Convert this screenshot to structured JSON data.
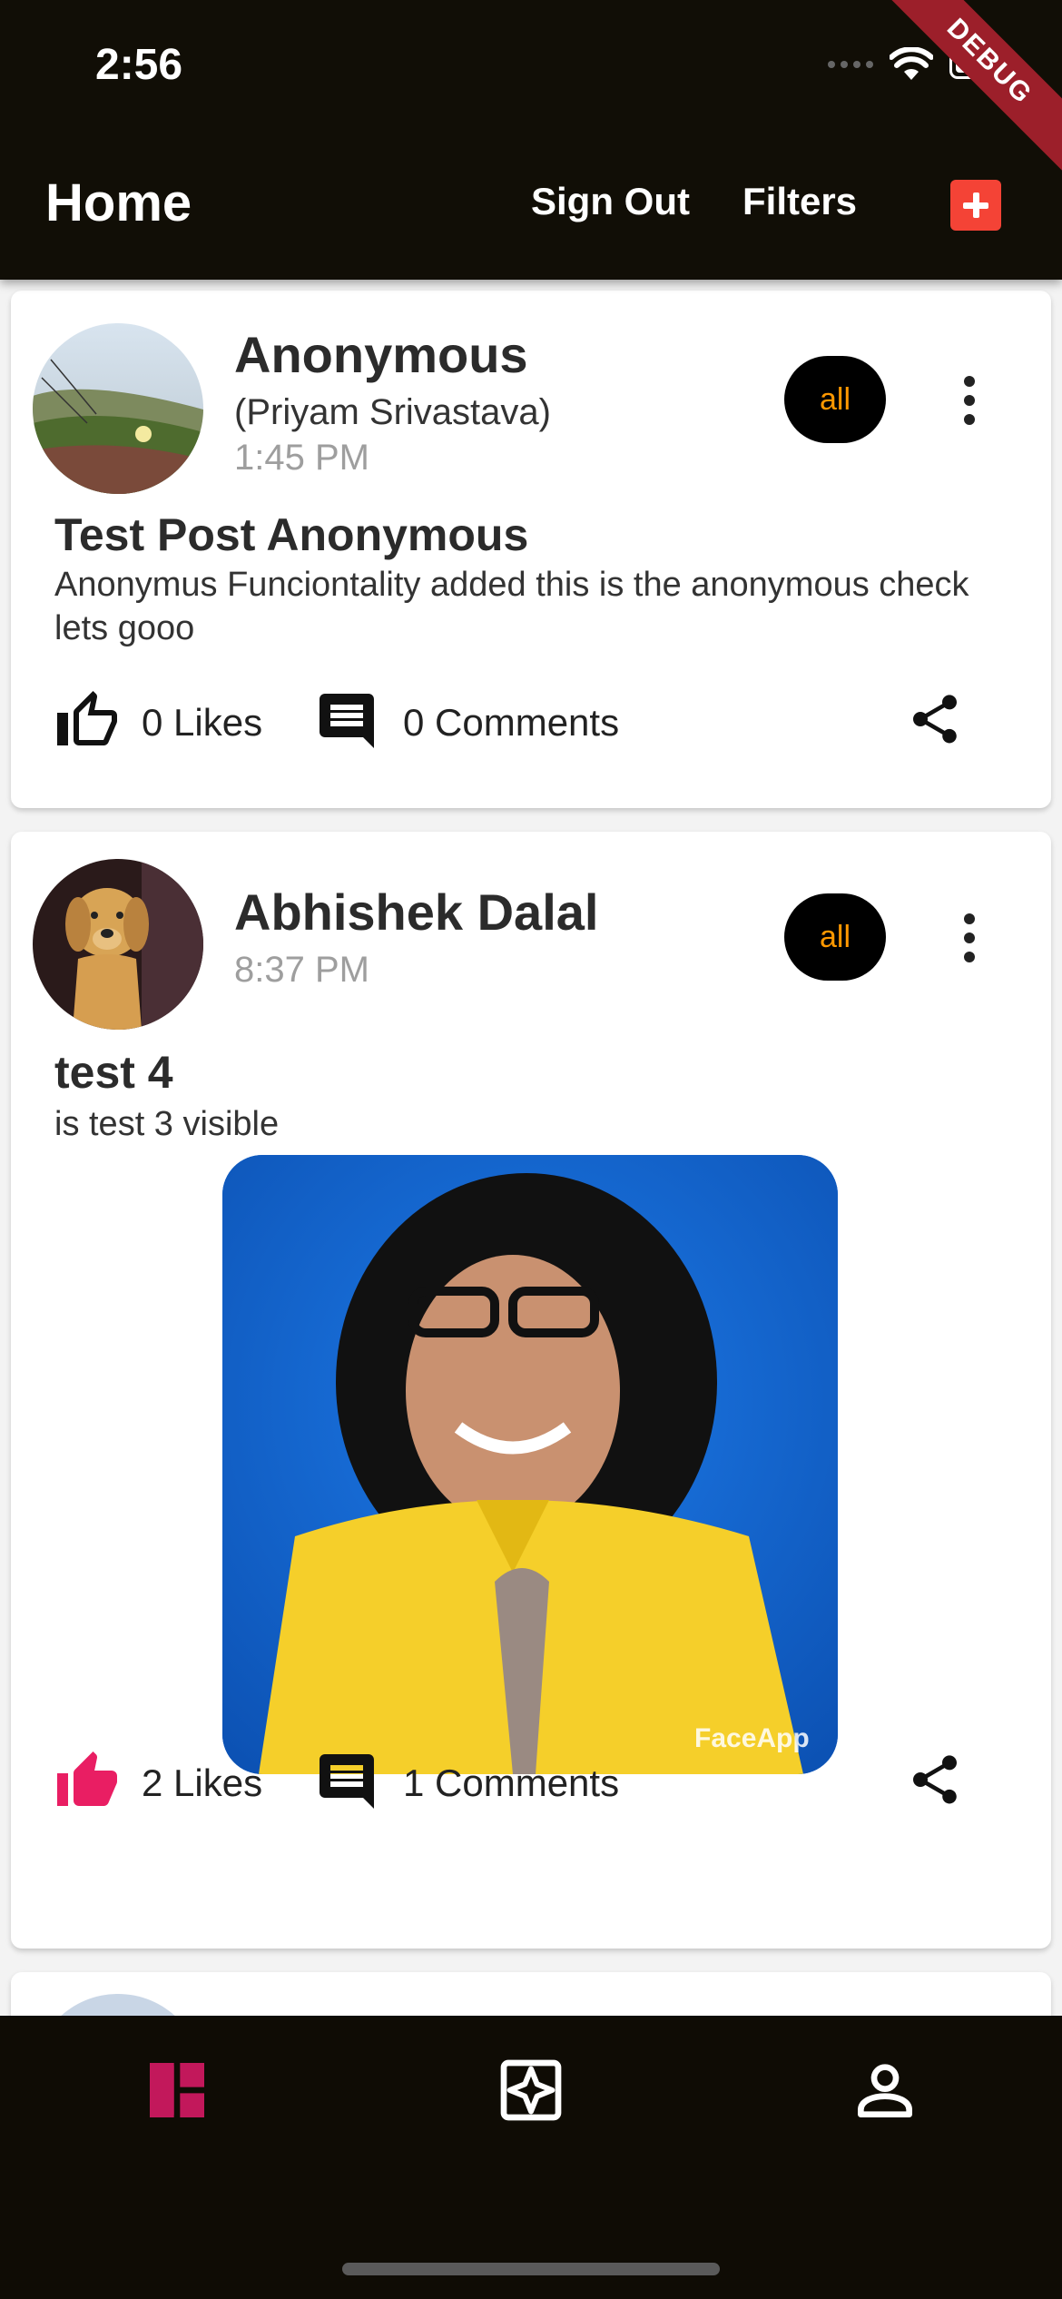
{
  "status_bar": {
    "time": "2:56",
    "debug_label": "DEBUG"
  },
  "app_bar": {
    "title": "Home",
    "sign_out_label": "Sign Out",
    "filters_label": "Filters",
    "add_icon": "add-box-icon",
    "accent_color": "#f44336"
  },
  "posts": [
    {
      "author": "Anonymous",
      "real_name": "(Priyam Srivastava)",
      "time": "1:45 PM",
      "audience": "all",
      "title": "Test Post Anonymous",
      "body": "Anonymus Funciontality added this is the anonymous check lets gooo",
      "likes_label": "0 Likes",
      "comments_label": "0 Comments",
      "liked": false
    },
    {
      "author": "Abhishek Dalal",
      "time": "8:37 PM",
      "audience": "all",
      "title": "test 4",
      "body": "is test 3 visible",
      "image_watermark": "FaceApp",
      "likes_label": "2 Likes",
      "comments_label": "1 Comments",
      "liked": true,
      "like_color": "#e91e63"
    }
  ],
  "bottom_nav": {
    "items": [
      {
        "icon": "dashboard-icon",
        "active": true,
        "color": "#c2185b"
      },
      {
        "icon": "puzzle-icon",
        "active": false
      },
      {
        "icon": "person-icon",
        "active": false
      }
    ]
  }
}
